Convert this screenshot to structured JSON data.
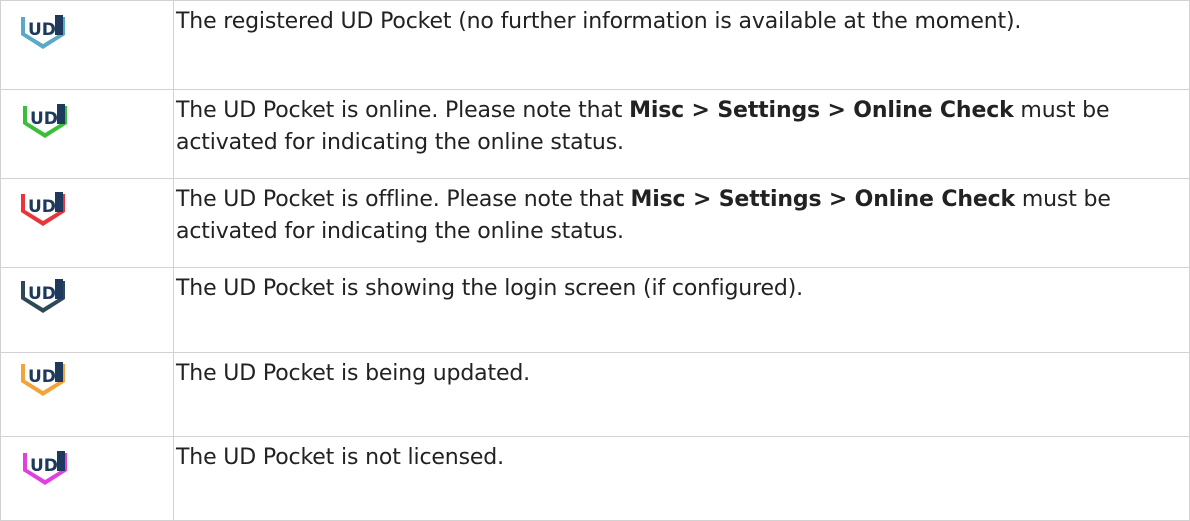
{
  "rows": [
    {
      "icon": "ud-pocket-registered-icon",
      "accent": "#5aa9c8",
      "dark": "#1d3a5c",
      "text": "The registered UD Pocket (no further information is available at the moment)."
    },
    {
      "icon": "ud-pocket-online-icon",
      "accent": "#3bbf3b",
      "dark": "#1d3a5c",
      "text_before": "The UD Pocket is online. Please note that ",
      "text_bold": "Misc > Settings > Online Check",
      "text_after": " must be activated for indicating the online status."
    },
    {
      "icon": "ud-pocket-offline-icon",
      "accent": "#e8343a",
      "dark": "#1d3a5c",
      "text_before": "The UD Pocket is offline. Please note that ",
      "text_bold": "Misc > Settings > Online Check",
      "text_after": " must be activated for indicating the online status."
    },
    {
      "icon": "ud-pocket-login-icon",
      "accent": "#2f4858",
      "dark": "#1d3a5c",
      "text": "The UD Pocket is showing the login screen (if configured)."
    },
    {
      "icon": "ud-pocket-updating-icon",
      "accent": "#f2a43a",
      "dark": "#1d3a5c",
      "text": "The UD Pocket is being updated."
    },
    {
      "icon": "ud-pocket-unlicensed-icon",
      "accent": "#e040e0",
      "dark": "#1d3a5c",
      "text": "The UD Pocket is not licensed."
    }
  ]
}
